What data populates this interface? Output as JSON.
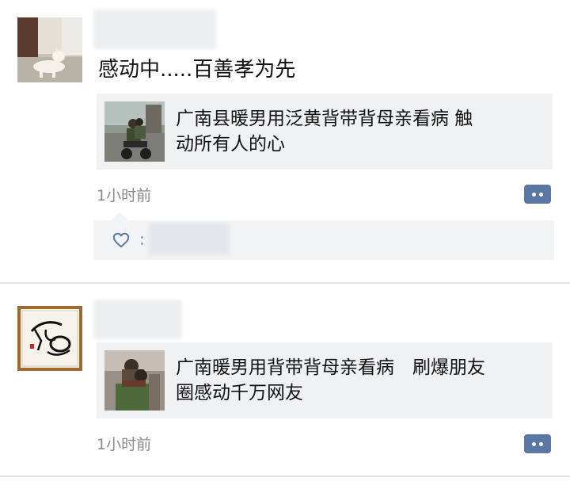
{
  "feed": {
    "posts": [
      {
        "author_avatar": "dog-avatar",
        "text": "感动中.....百善孝为先",
        "link": {
          "thumbnail": "man-carrying-mother-on-scooter-thumbnail",
          "title": "广南县暖男用泛黄背带背母亲看病 触\n动所有人的心"
        },
        "time": "1小时前",
        "comment_icon": "comment-icon",
        "like_icon": "heart-icon"
      },
      {
        "author_avatar": "calligraphy-avatar",
        "link": {
          "thumbnail": "man-carrying-mother-on-back-thumbnail",
          "title": "广南暖男用背带背母亲看病　刷爆朋友\n圈感动千万网友"
        },
        "time": "1小时前",
        "comment_icon": "comment-icon"
      }
    ]
  },
  "colors": {
    "card_bg": "#f0f1f3",
    "time_text": "#8a8a8a",
    "comment_button": "#5b77a3",
    "like_heart": "#5b77a3"
  }
}
